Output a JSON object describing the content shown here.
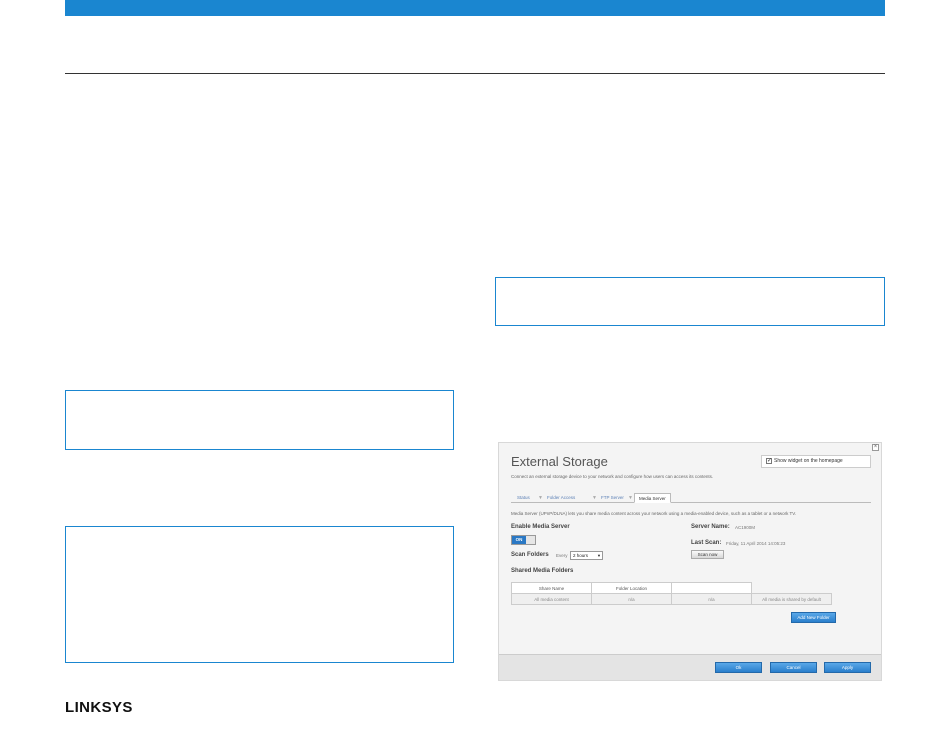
{
  "brand": {
    "logo_text": "LINKSYS"
  },
  "colors": {
    "accent": "#1a86d0",
    "button_blue": "#2a7fcc"
  },
  "screenshot": {
    "close_icon": "close-icon",
    "title": "External Storage",
    "widget_label": "Show widget on the homepage",
    "description": "Connect an external storage device to your network and configure how users can access its contents.",
    "tabs": [
      {
        "label": "Status"
      },
      {
        "label": "Folder Access"
      },
      {
        "label": "FTP Server"
      },
      {
        "label": "Media Server"
      }
    ],
    "media_server_desc": "Media Server (UPnP/DLNA) lets you share media content across your network using a media-enabled device, such as a tablet or a network TV.",
    "enable_label": "Enable Media Server",
    "toggle_label": "ON",
    "scan_label": "Scan Folders",
    "scan_every": "Every",
    "scan_interval": "2 hours",
    "server_name_label": "Server Name:",
    "server_name_value": "AC1900M",
    "last_scan_label": "Last Scan:",
    "last_scan_value": "Friday, 11 April 2014 14:05:23",
    "scan_now": "Scan now",
    "shared_heading": "Shared Media Folders",
    "table_headers": [
      "Share Name",
      "Folder Location"
    ],
    "table_row": [
      "All media content",
      "n/a",
      "n/a",
      "All media is shared by default"
    ],
    "add_folder": "Add New Folder",
    "ok": "Ok",
    "cancel": "Cancel",
    "apply": "Apply"
  }
}
